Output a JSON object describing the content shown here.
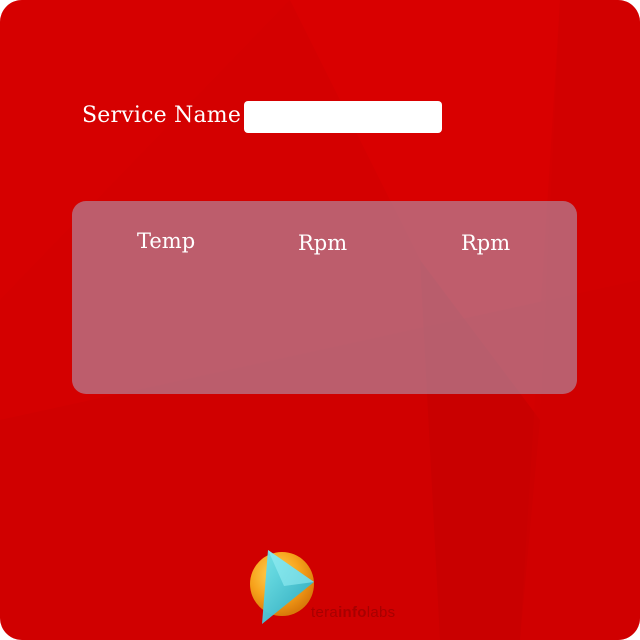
{
  "form": {
    "service_label": "Service Name",
    "service_value": ""
  },
  "readings_panel": {
    "headers": [
      "Temp",
      "Rpm",
      "Rpm"
    ]
  },
  "brand": {
    "logo_prefix": "tera",
    "logo_middle": "info",
    "logo_suffix": "labs",
    "logo_icon": "play-triangle-icon"
  },
  "colors": {
    "background": "#d40000",
    "panel": "#b496af",
    "text": "#ffffff",
    "logo_orange": "#f7a21b",
    "logo_cyan": "#3ec8d8"
  }
}
